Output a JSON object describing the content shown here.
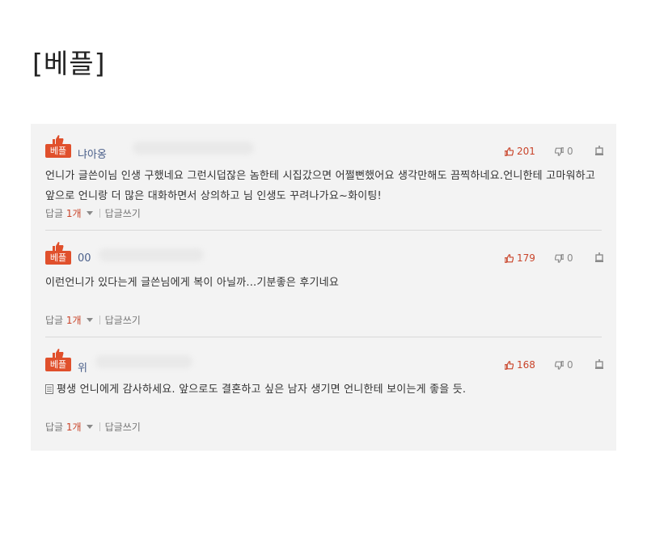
{
  "page": {
    "heading": "[베플]"
  },
  "badge_label": "베플",
  "comments": [
    {
      "nickname": "냐아옹",
      "likes": "201",
      "dislikes": "0",
      "text": "언니가 글쓴이님 인생 구했네요 그런시덥잖은 놈한테 시집갔으면 어쩔뻔했어요 생각만해도 끔찍하네요.언니한테 고마워하고 앞으로 언니랑 더 많은 대화하면서 상의하고 님 인생도 꾸려나가요~화이팅!",
      "reply_label": "답글",
      "reply_count": "1개",
      "write_reply": "답글쓰기"
    },
    {
      "nickname": "00",
      "likes": "179",
      "dislikes": "0",
      "text": "이런언니가 있다는게 글쓴님에게 복이 아닐까...기분좋은 후기네요",
      "reply_label": "답글",
      "reply_count": "1개",
      "write_reply": "답글쓰기"
    },
    {
      "nickname": "위",
      "likes": "168",
      "dislikes": "0",
      "text": "평생 언니에게 감사하세요. 앞으로도 결혼하고 싶은 남자 생기면 언니한테 보이는게 좋을 듯.",
      "reply_label": "답글",
      "reply_count": "1개",
      "write_reply": "답글쓰기"
    }
  ],
  "colors": {
    "badge": "#e0502c",
    "like": "#c9442a",
    "nickname": "#4a5f8a",
    "panel": "#f3f3f3"
  },
  "icons": [
    "thumbs-up-icon",
    "thumbs-down-icon",
    "report-icon",
    "caret-down-icon",
    "document-icon"
  ]
}
